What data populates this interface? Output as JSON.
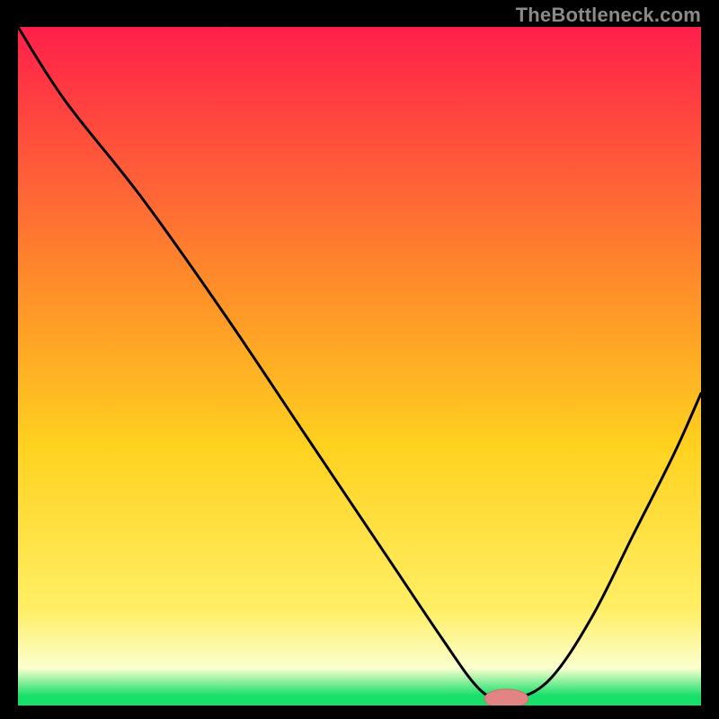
{
  "watermark": "TheBottleneck.com",
  "colors": {
    "black": "#000000",
    "line": "#000000",
    "marker_fill": "#e38484",
    "marker_stroke": "#d76a6a",
    "grad_top": "#ff1f4b",
    "grad_mid_upper": "#ff8a2a",
    "grad_mid": "#ffd21f",
    "grad_lower": "#ffef66",
    "grad_pale": "#fbffcf",
    "grad_green": "#19e06b"
  },
  "chart_data": {
    "type": "line",
    "title": "",
    "xlabel": "",
    "ylabel": "",
    "xlim": [
      0,
      100
    ],
    "ylim": [
      0,
      100
    ],
    "x": [
      0,
      7,
      18,
      30,
      42,
      54,
      62,
      67,
      70,
      73,
      78,
      84,
      90,
      96,
      100
    ],
    "values": [
      100,
      89,
      75,
      58,
      40,
      22,
      10,
      3,
      1,
      1,
      4,
      13,
      25,
      37,
      46
    ],
    "marker": {
      "x": 71.5,
      "y": 1,
      "rx": 3.2,
      "ry": 1.4
    },
    "gradient_stops": [
      {
        "offset": 0.0,
        "key": "grad_top"
      },
      {
        "offset": 0.37,
        "key": "grad_mid_upper"
      },
      {
        "offset": 0.62,
        "key": "grad_mid"
      },
      {
        "offset": 0.86,
        "key": "grad_lower"
      },
      {
        "offset": 0.945,
        "key": "grad_pale"
      },
      {
        "offset": 0.985,
        "key": "grad_green"
      },
      {
        "offset": 1.0,
        "key": "grad_green"
      }
    ]
  }
}
